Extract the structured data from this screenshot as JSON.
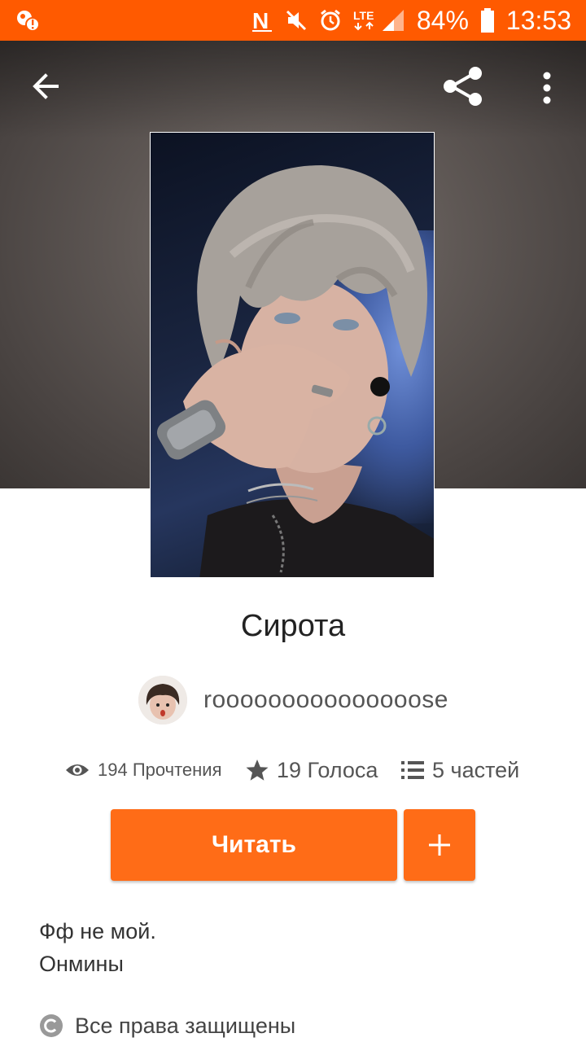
{
  "status_bar": {
    "battery": "84%",
    "time": "13:53",
    "network": "LTE",
    "colors": {
      "background": "#ff5a00"
    }
  },
  "toolbar": {
    "back_icon": "arrow-left-icon",
    "share_icon": "share-icon",
    "more_icon": "more-vertical-icon"
  },
  "story": {
    "title": "Сирота",
    "author": "rooooooooooooooose",
    "stats": {
      "reads": "194 Прочтения",
      "votes": "19 Голоса",
      "parts": "5 частей"
    },
    "read_button": "Читать",
    "add_button": "+",
    "description_lines": [
      "Фф не мой.",
      "Онмины"
    ],
    "rights": "Все права защищены"
  },
  "colors": {
    "accent": "#ff6c17"
  }
}
